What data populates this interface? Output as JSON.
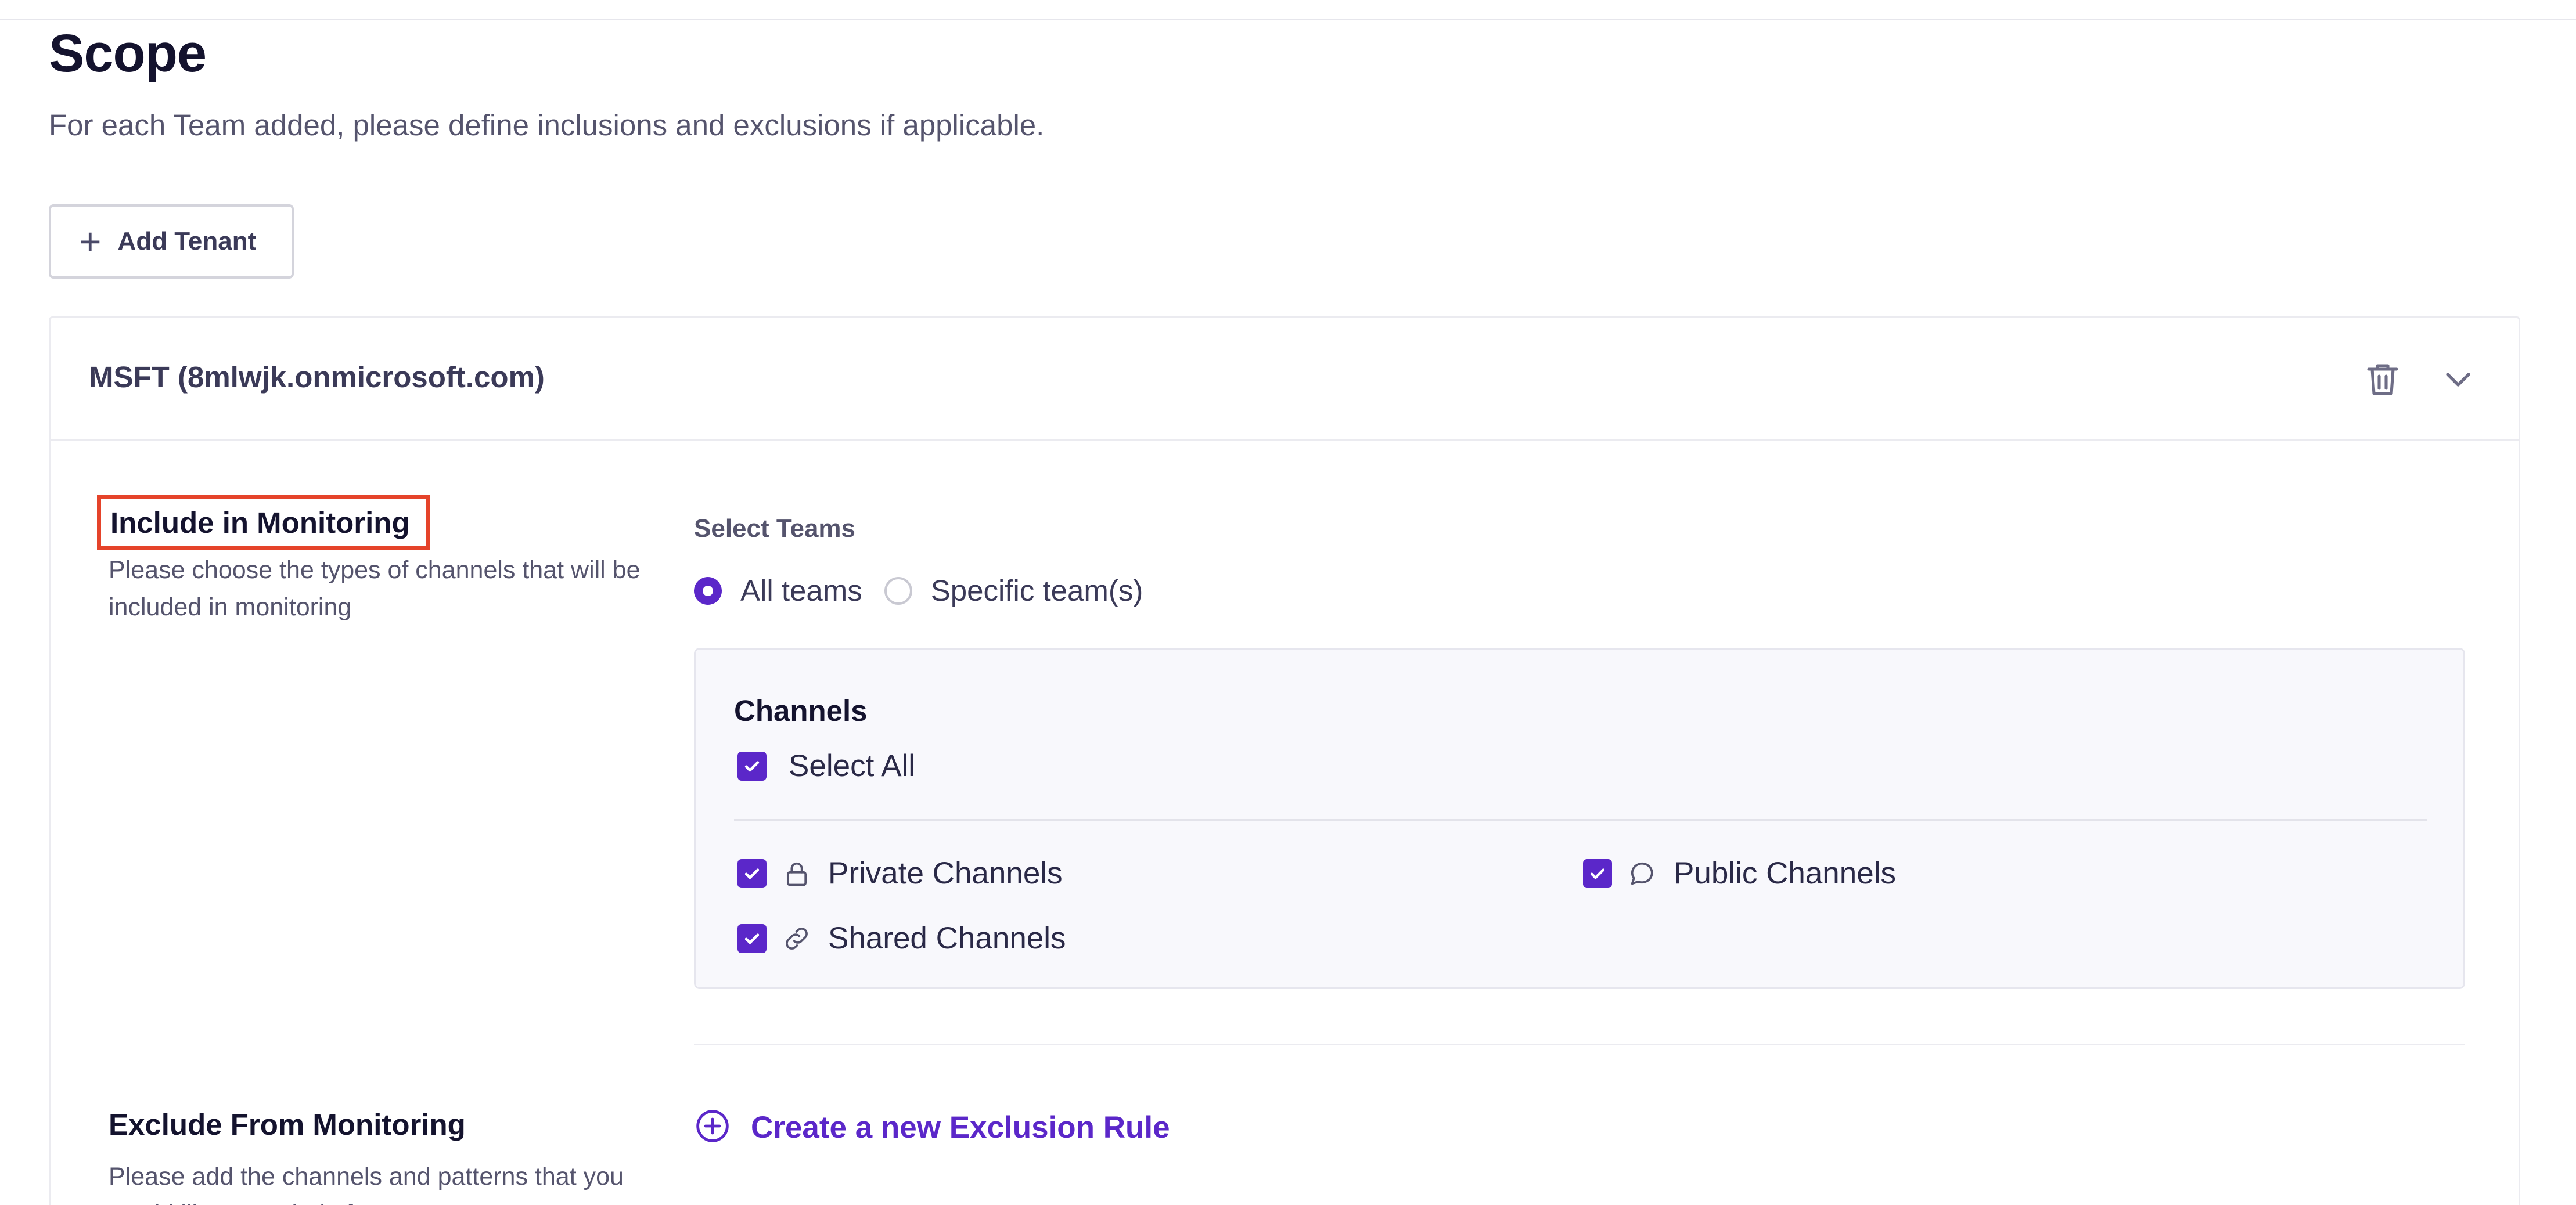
{
  "page": {
    "title": "Scope",
    "subtitle": "For each Team added, please define inclusions and exclusions if applicable."
  },
  "toolbar": {
    "add_tenant_label": "Add Tenant"
  },
  "tenant": {
    "name": "MSFT (8mlwjk.onmicrosoft.com)",
    "include": {
      "title": "Include in Monitoring",
      "description": "Please choose the types of channels that will be included in monitoring"
    },
    "select_teams": {
      "label": "Select Teams",
      "options": [
        "All teams",
        "Specific team(s)"
      ],
      "selected": "All teams"
    },
    "channels": {
      "title": "Channels",
      "select_all_label": "Select All",
      "select_all_checked": true,
      "items": [
        {
          "label": "Private Channels",
          "icon": "lock-icon",
          "checked": true
        },
        {
          "label": "Public Channels",
          "icon": "chat-bubble-icon",
          "checked": true
        },
        {
          "label": "Shared Channels",
          "icon": "link-icon",
          "checked": true
        }
      ]
    },
    "exclude": {
      "title": "Exclude From Monitoring",
      "description": "Please add the channels and patterns that you would like to exclude from"
    },
    "create_rule_label": "Create a new Exclusion Rule"
  },
  "colors": {
    "accent": "#5b27c9",
    "highlight_border": "#e5432a"
  }
}
